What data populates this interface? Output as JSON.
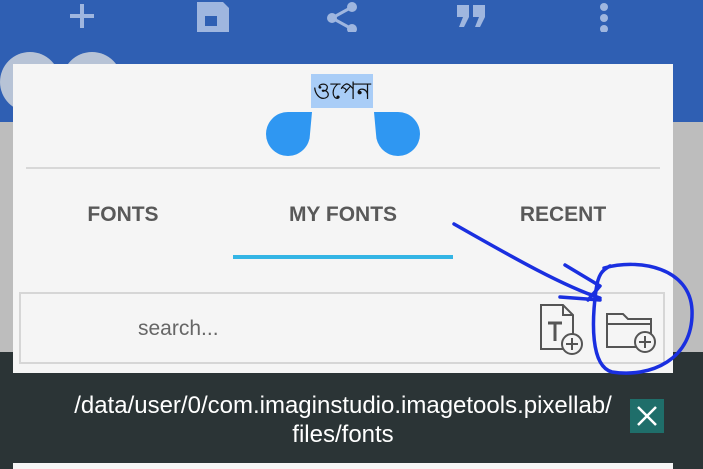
{
  "toolbar": {
    "icons": [
      "plus-icon",
      "save-icon",
      "share-icon",
      "quote-icon",
      "more-vert-icon"
    ]
  },
  "dialog": {
    "preview_text": "ওপেন",
    "tabs": [
      {
        "label": "FONTS",
        "selected": false
      },
      {
        "label": "MY FONTS",
        "selected": true
      },
      {
        "label": "RECENT",
        "selected": false
      }
    ],
    "search": {
      "placeholder": "search...",
      "value": ""
    },
    "actions": [
      "add-font-file-icon",
      "add-font-folder-icon"
    ]
  },
  "toast": {
    "line1": "/data/user/0/com.imaginstudio.imagetools.pixellab/",
    "line2": "files/fonts",
    "close_icon": "close-icon"
  },
  "colors": {
    "appbar": "#2f5fb3",
    "accent_tab": "#34b5e5",
    "preview_highlight": "#a9cdf7",
    "toast_bg": "#2b3436",
    "annotation_ink": "#1a2fe0"
  }
}
